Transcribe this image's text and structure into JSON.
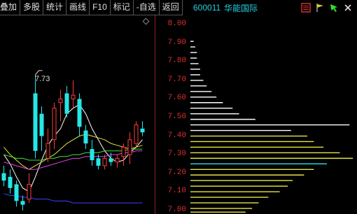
{
  "toolbar": {
    "items": [
      {
        "label": "叠加",
        "name": "overlay-button"
      },
      {
        "label": "多股",
        "name": "multi-stock-button"
      },
      {
        "label": "统计",
        "name": "statistics-button"
      },
      {
        "label": "画线",
        "name": "draw-line-button"
      },
      {
        "label": "F10",
        "name": "f10-button"
      },
      {
        "label": "标记",
        "name": "mark-button"
      },
      {
        "label": "-自选",
        "name": "remove-watchlist-button"
      },
      {
        "label": "返回",
        "name": "back-button"
      }
    ]
  },
  "stock": {
    "code": "600011",
    "name": "华能国际"
  },
  "header_icons": [
    "grid-icon",
    "flag-icon",
    "cursor-icon",
    "close-icon"
  ],
  "annotation": {
    "label": "7.73"
  },
  "price_scale": {
    "ticks": [
      "8.00",
      "7.90",
      "7.80",
      "7.70",
      "7.60",
      "7.50",
      "7.40",
      "7.30",
      "7.20",
      "7.10",
      "7.00"
    ]
  },
  "colors": {
    "up": "#ff3b3b",
    "down": "#26e6e6",
    "ma5": "#ffffff",
    "ma10": "#e6e640",
    "ma20": "#e040e0",
    "ma30": "#40e040",
    "ma60": "#4040ff",
    "accent": "#26d0e6",
    "scale": "#e03030"
  },
  "chart_data": {
    "type": "candlestick",
    "ylim": [
      6.98,
      8.05
    ],
    "candles": [
      {
        "o": 7.2,
        "h": 7.24,
        "l": 7.13,
        "c": 7.16
      },
      {
        "o": 7.18,
        "h": 7.22,
        "l": 7.09,
        "c": 7.12
      },
      {
        "o": 7.14,
        "h": 7.16,
        "l": 7.02,
        "c": 7.05
      },
      {
        "o": 7.05,
        "h": 7.08,
        "l": 7.0,
        "c": 7.03
      },
      {
        "o": 7.06,
        "h": 7.2,
        "l": 7.04,
        "c": 7.14
      },
      {
        "o": 7.63,
        "h": 7.73,
        "l": 7.28,
        "c": 7.32
      },
      {
        "o": 7.52,
        "h": 7.56,
        "l": 7.32,
        "c": 7.4
      },
      {
        "o": 7.28,
        "h": 7.44,
        "l": 7.26,
        "c": 7.36
      },
      {
        "o": 7.38,
        "h": 7.58,
        "l": 7.33,
        "c": 7.55
      },
      {
        "o": 7.58,
        "h": 7.65,
        "l": 7.48,
        "c": 7.6
      },
      {
        "o": 7.63,
        "h": 7.67,
        "l": 7.5,
        "c": 7.52
      },
      {
        "o": 7.6,
        "h": 7.7,
        "l": 7.55,
        "c": 7.62
      },
      {
        "o": 7.6,
        "h": 7.63,
        "l": 7.4,
        "c": 7.45
      },
      {
        "o": 7.43,
        "h": 7.46,
        "l": 7.33,
        "c": 7.36
      },
      {
        "o": 7.33,
        "h": 7.38,
        "l": 7.24,
        "c": 7.27
      },
      {
        "o": 7.28,
        "h": 7.3,
        "l": 7.22,
        "c": 7.24
      },
      {
        "o": 7.24,
        "h": 7.3,
        "l": 7.22,
        "c": 7.28
      },
      {
        "o": 7.28,
        "h": 7.31,
        "l": 7.24,
        "c": 7.26
      },
      {
        "o": 7.26,
        "h": 7.3,
        "l": 7.23,
        "c": 7.28
      },
      {
        "o": 7.29,
        "h": 7.36,
        "l": 7.24,
        "c": 7.34
      },
      {
        "o": 7.3,
        "h": 7.42,
        "l": 7.25,
        "c": 7.38
      },
      {
        "o": 7.36,
        "h": 7.48,
        "l": 7.34,
        "c": 7.46
      },
      {
        "o": 7.44,
        "h": 7.48,
        "l": 7.4,
        "c": 7.42
      }
    ],
    "ma_lines": [
      {
        "name": "MA5",
        "values": [
          7.3,
          7.25,
          7.18,
          7.12,
          7.1,
          7.18,
          7.27,
          7.35,
          7.4,
          7.44,
          7.52,
          7.55,
          7.57,
          7.52,
          7.44,
          7.38,
          7.32,
          7.28,
          7.26,
          7.27,
          7.31,
          7.34,
          7.38
        ]
      },
      {
        "name": "MA10",
        "values": [
          7.34,
          7.3,
          7.27,
          7.24,
          7.22,
          7.24,
          7.26,
          7.28,
          7.3,
          7.33,
          7.36,
          7.38,
          7.4,
          7.41,
          7.4,
          7.39,
          7.38,
          7.36,
          7.35,
          7.34,
          7.33,
          7.34,
          7.35
        ]
      },
      {
        "name": "MA20",
        "values": [
          7.26,
          7.25,
          7.24,
          7.23,
          7.22,
          7.22,
          7.23,
          7.24,
          7.25,
          7.26,
          7.27,
          7.28,
          7.28,
          7.29,
          7.29,
          7.29,
          7.29,
          7.3,
          7.3,
          7.31,
          7.31,
          7.32,
          7.32
        ]
      },
      {
        "name": "MA30",
        "values": [
          7.3,
          7.29,
          7.28,
          7.28,
          7.27,
          7.27,
          7.27,
          7.28,
          7.28,
          7.29,
          7.29,
          7.3,
          7.3,
          7.31,
          7.31,
          7.31,
          7.32,
          7.32,
          7.32,
          7.32,
          7.33,
          7.33,
          7.33
        ]
      },
      {
        "name": "MA60",
        "values": [
          7.09,
          7.08,
          7.08,
          7.07,
          7.07,
          7.06,
          7.06,
          7.06,
          7.05,
          7.05,
          7.05,
          7.04,
          7.04,
          7.04,
          7.04,
          7.04,
          7.04,
          7.04,
          7.04,
          7.04,
          7.04,
          7.04,
          7.04
        ]
      }
    ],
    "volume_profile": {
      "bins": [
        {
          "p": 7.91,
          "v": 0.02,
          "c": "w"
        },
        {
          "p": 7.88,
          "v": 0.03,
          "c": "w"
        },
        {
          "p": 7.85,
          "v": 0.04,
          "c": "w"
        },
        {
          "p": 7.82,
          "v": 0.04,
          "c": "w"
        },
        {
          "p": 7.79,
          "v": 0.05,
          "c": "w"
        },
        {
          "p": 7.76,
          "v": 0.06,
          "c": "w"
        },
        {
          "p": 7.73,
          "v": 0.06,
          "c": "w"
        },
        {
          "p": 7.7,
          "v": 0.08,
          "c": "w"
        },
        {
          "p": 7.67,
          "v": 0.1,
          "c": "w"
        },
        {
          "p": 7.64,
          "v": 0.13,
          "c": "w"
        },
        {
          "p": 7.61,
          "v": 0.16,
          "c": "w"
        },
        {
          "p": 7.58,
          "v": 0.2,
          "c": "w"
        },
        {
          "p": 7.55,
          "v": 0.26,
          "c": "w"
        },
        {
          "p": 7.52,
          "v": 0.3,
          "c": "w"
        },
        {
          "p": 7.49,
          "v": 0.4,
          "c": "w"
        },
        {
          "p": 7.46,
          "v": 0.98,
          "c": "w"
        },
        {
          "p": 7.43,
          "v": 0.62,
          "c": "w"
        },
        {
          "p": 7.4,
          "v": 0.72,
          "c": "y"
        },
        {
          "p": 7.37,
          "v": 0.76,
          "c": "y"
        },
        {
          "p": 7.34,
          "v": 0.82,
          "c": "y"
        },
        {
          "p": 7.31,
          "v": 0.92,
          "c": "y"
        },
        {
          "p": 7.28,
          "v": 1.0,
          "c": "y"
        },
        {
          "p": 7.25,
          "v": 0.84,
          "c": "c"
        },
        {
          "p": 7.22,
          "v": 0.76,
          "c": "y"
        },
        {
          "p": 7.19,
          "v": 0.7,
          "c": "y"
        },
        {
          "p": 7.16,
          "v": 0.63,
          "c": "y"
        },
        {
          "p": 7.13,
          "v": 0.6,
          "c": "y"
        },
        {
          "p": 7.1,
          "v": 0.55,
          "c": "y"
        },
        {
          "p": 7.07,
          "v": 0.48,
          "c": "y"
        },
        {
          "p": 7.04,
          "v": 0.42,
          "c": "y"
        },
        {
          "p": 7.01,
          "v": 0.38,
          "c": "y"
        },
        {
          "p": 6.99,
          "v": 0.34,
          "c": "y"
        }
      ]
    }
  }
}
